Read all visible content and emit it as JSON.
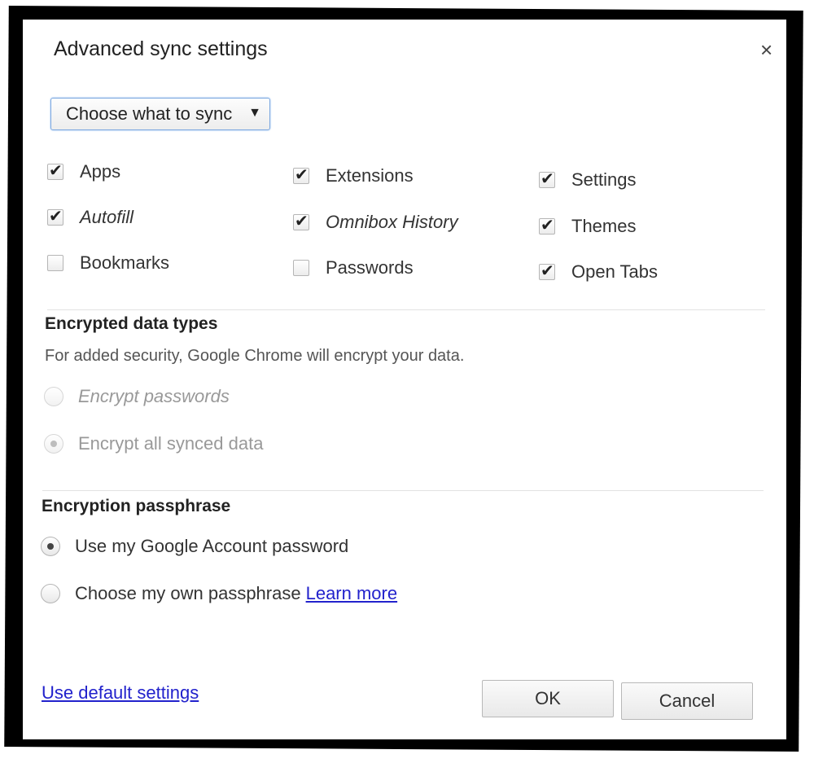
{
  "dialog": {
    "title": "Advanced sync settings",
    "close_symbol": "×"
  },
  "sync_dropdown": {
    "selected": "Choose what to sync",
    "arrow": "▼"
  },
  "sync_items": [
    {
      "label": "Apps",
      "checked": true
    },
    {
      "label": "Autofill",
      "checked": true
    },
    {
      "label": "Bookmarks",
      "checked": false
    },
    {
      "label": "Extensions",
      "checked": true
    },
    {
      "label": "Omnibox History",
      "checked": true
    },
    {
      "label": "Passwords",
      "checked": false
    },
    {
      "label": "Settings",
      "checked": true
    },
    {
      "label": "Themes",
      "checked": true
    },
    {
      "label": "Open Tabs",
      "checked": true
    }
  ],
  "encrypted": {
    "title": "Encrypted data types",
    "description": "For added security, Google Chrome will encrypt your data.",
    "options": [
      {
        "label": "Encrypt passwords",
        "selected": false
      },
      {
        "label": "Encrypt all synced data",
        "selected": true
      }
    ]
  },
  "passphrase": {
    "title": "Encryption passphrase",
    "options": [
      {
        "label": "Use my Google Account password",
        "selected": true
      },
      {
        "label": "Choose my own passphrase",
        "selected": false
      }
    ],
    "learn_more": "Learn more"
  },
  "footer": {
    "defaults_link": "Use default settings",
    "ok_label": "OK",
    "cancel_label": "Cancel"
  }
}
